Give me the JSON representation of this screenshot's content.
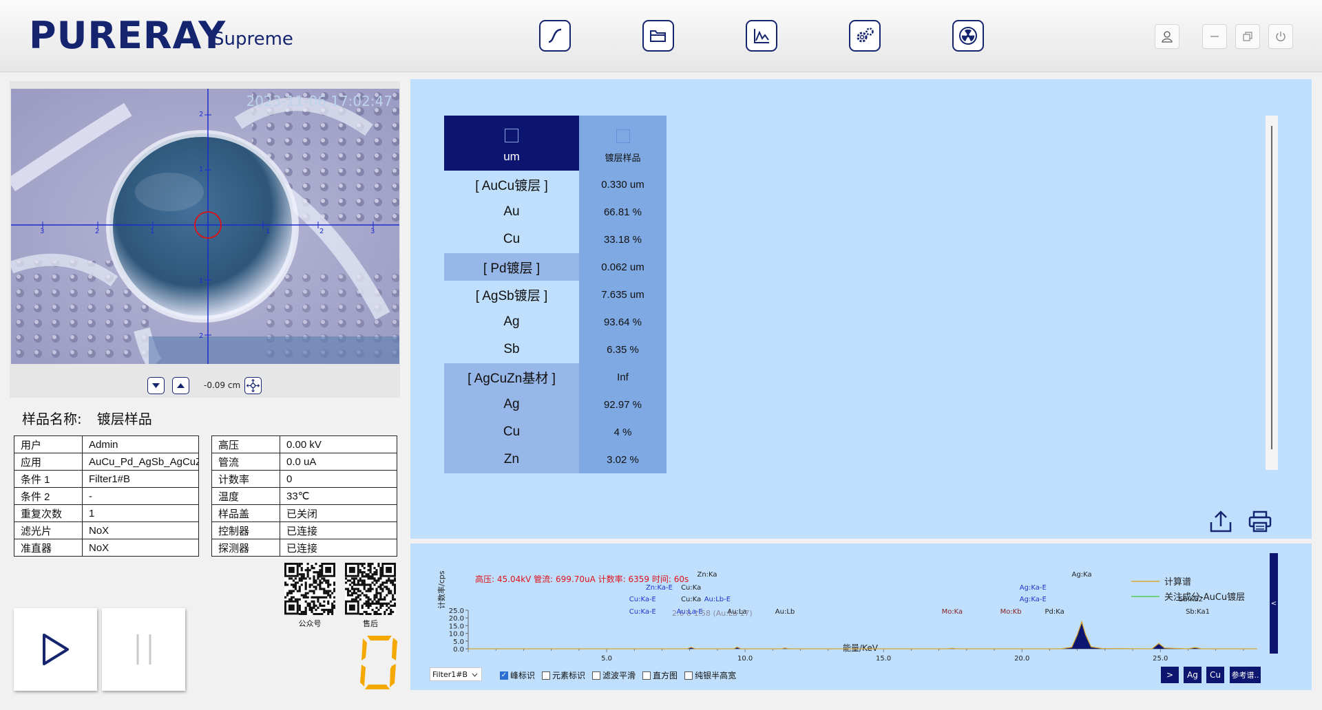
{
  "header": {
    "logo": "PURERAY",
    "logo_sub": "Supreme",
    "nav": [
      "curve-icon",
      "folder-icon",
      "spectrum-icon",
      "settings-icon",
      "radiation-icon"
    ],
    "window": [
      "user-icon",
      "minimize-icon",
      "restore-icon",
      "power-icon"
    ]
  },
  "camera": {
    "timestamp": "2023-11-06 17:02:47",
    "scale_value": "-0.09 cm",
    "axis_labels_h": [
      "3",
      "2",
      "1",
      "1",
      "2",
      "3"
    ],
    "axis_labels_v": [
      "2",
      "1",
      "1",
      "2"
    ]
  },
  "sample": {
    "label": "样品名称:",
    "name": "镀层样品"
  },
  "info_left": [
    {
      "k": "用户",
      "v": "Admin"
    },
    {
      "k": "应用",
      "v": "AuCu_Pd_AgSb_AgCuZn"
    },
    {
      "k": "条件 1",
      "v": "Filter1#B"
    },
    {
      "k": "条件 2",
      "v": "-"
    },
    {
      "k": "重复次数",
      "v": "1"
    },
    {
      "k": "滤光片",
      "v": "NoX"
    },
    {
      "k": "准直器",
      "v": "NoX"
    }
  ],
  "info_right": [
    {
      "k": "高压",
      "v": "0.00 kV"
    },
    {
      "k": "管流",
      "v": "0.0 uA"
    },
    {
      "k": "计数率",
      "v": "0"
    },
    {
      "k": "温度",
      "v": "33℃"
    },
    {
      "k": "样品盖",
      "v": "已关闭"
    },
    {
      "k": "控制器",
      "v": "已连接"
    },
    {
      "k": "探测器",
      "v": "已连接"
    }
  ],
  "qr": [
    {
      "label": "公众号"
    },
    {
      "label": "售后"
    }
  ],
  "counter": "0",
  "results": {
    "header_left": "um",
    "header_right": "镀层样品",
    "rows": [
      {
        "l": "[ AuCu镀层 ]",
        "r": "0.330 um",
        "hl": false
      },
      {
        "l": "Au",
        "r": "66.81 %",
        "hl": false
      },
      {
        "l": "Cu",
        "r": "33.18 %",
        "hl": false
      },
      {
        "l": "[ Pd镀层 ]",
        "r": "0.062 um",
        "hl": true
      },
      {
        "l": "[ AgSb镀层 ]",
        "r": "7.635 um",
        "hl": false
      },
      {
        "l": "Ag",
        "r": "93.64 %",
        "hl": false
      },
      {
        "l": "Sb",
        "r": "6.35 %",
        "hl": false
      },
      {
        "l": "[ AgCuZn基材 ]",
        "r": "Inf",
        "hl": true
      },
      {
        "l": "Ag",
        "r": "92.97 %",
        "hl": true
      },
      {
        "l": "Cu",
        "r": "4 %",
        "hl": true
      },
      {
        "l": "Zn",
        "r": "3.02 %",
        "hl": true
      }
    ]
  },
  "spectrum": {
    "status": "高压: 45.04kV  管流: 699.70uA  计数率: 6359  时间: 60s",
    "ylabel": "计数率/cps",
    "xlabel": "能量/KeV",
    "cursor_text": "2.6 8 1.58 (Au:La 17)",
    "legend": [
      "计算谱",
      "关注成分-AuCu镀层"
    ],
    "filter_select": "Filter1#B",
    "checks": [
      {
        "label": "峰标识",
        "on": true
      },
      {
        "label": "元素标识",
        "on": false
      },
      {
        "label": "滤波平滑",
        "on": false
      },
      {
        "label": "直方图",
        "on": false
      },
      {
        "label": "纯银半高宽",
        "on": false
      }
    ],
    "buttons": [
      ">",
      "Ag",
      "Cu",
      "参考谱.."
    ],
    "side_tab": "<",
    "peak_labels": [
      {
        "t": "Zn:Ka",
        "x": 8.63,
        "row": 0,
        "c": "#222"
      },
      {
        "t": "Zn:Ka-E",
        "x": 6.9,
        "row": 1,
        "c": "#2233cc"
      },
      {
        "t": "Cu:Ka",
        "x": 8.05,
        "row": 1,
        "c": "#222"
      },
      {
        "t": "Cu:Ka-E",
        "x": 6.3,
        "row": 2,
        "c": "#2233cc"
      },
      {
        "t": "Cu:Ka",
        "x": 8.05,
        "row": 2,
        "c": "#222"
      },
      {
        "t": "Au:Lb-E",
        "x": 9.0,
        "row": 2,
        "c": "#2233cc"
      },
      {
        "t": "Cu:Ka-E",
        "x": 6.3,
        "row": 3,
        "c": "#2233cc"
      },
      {
        "t": "Au:La-E",
        "x": 8.0,
        "row": 3,
        "c": "#2233cc"
      },
      {
        "t": "Au:La",
        "x": 9.71,
        "row": 3,
        "c": "#222"
      },
      {
        "t": "Au:Lb",
        "x": 11.44,
        "row": 3,
        "c": "#222"
      },
      {
        "t": "Mo:Ka",
        "x": 17.48,
        "row": 3,
        "c": "#882222"
      },
      {
        "t": "Mo:Kb",
        "x": 19.6,
        "row": 3,
        "c": "#882222"
      },
      {
        "t": "Pd:Ka",
        "x": 21.18,
        "row": 3,
        "c": "#222"
      },
      {
        "t": "Ag:Ka-E",
        "x": 20.4,
        "row": 1,
        "c": "#2233cc"
      },
      {
        "t": "Ag:Ka-E",
        "x": 20.4,
        "row": 2,
        "c": "#2233cc"
      },
      {
        "t": "Ag:Ka",
        "x": 22.16,
        "row": 0,
        "c": "#222"
      },
      {
        "t": "Sb:Ka2",
        "x": 26.1,
        "row": 2,
        "c": "#222"
      },
      {
        "t": "Sb:Ka1",
        "x": 26.35,
        "row": 3,
        "c": "#222"
      }
    ]
  },
  "chart_data": {
    "type": "line",
    "title": "",
    "xlabel": "能量/KeV",
    "ylabel": "计数率/cps",
    "xlim": [
      0,
      28.5
    ],
    "ylim": [
      0,
      25
    ],
    "x_ticks": [
      "5.0",
      "10.0",
      "15.0",
      "20.0",
      "25.0"
    ],
    "y_ticks": [
      "0.0",
      "5.0",
      "10.0",
      "15.0",
      "20.0",
      "25.0"
    ],
    "series": [
      {
        "name": "计算谱",
        "color": "#d9a530",
        "points": [
          [
            0,
            0
          ],
          [
            7.9,
            0
          ],
          [
            8.05,
            1.0
          ],
          [
            8.2,
            0
          ],
          [
            9.6,
            0
          ],
          [
            9.71,
            1.1
          ],
          [
            9.85,
            0
          ],
          [
            11.3,
            0
          ],
          [
            11.44,
            0.5
          ],
          [
            11.6,
            0
          ],
          [
            17.3,
            0
          ],
          [
            17.48,
            0.3
          ],
          [
            17.65,
            0
          ],
          [
            21.4,
            0
          ],
          [
            21.8,
            1.0
          ],
          [
            22.0,
            9.0
          ],
          [
            22.16,
            17.5
          ],
          [
            22.3,
            9.0
          ],
          [
            22.5,
            1.2
          ],
          [
            22.9,
            0.2
          ],
          [
            24.7,
            0
          ],
          [
            24.94,
            3.5
          ],
          [
            25.15,
            0.5
          ],
          [
            26.0,
            0
          ],
          [
            26.25,
            0.8
          ],
          [
            26.5,
            0
          ],
          [
            28.5,
            0
          ]
        ]
      }
    ]
  }
}
